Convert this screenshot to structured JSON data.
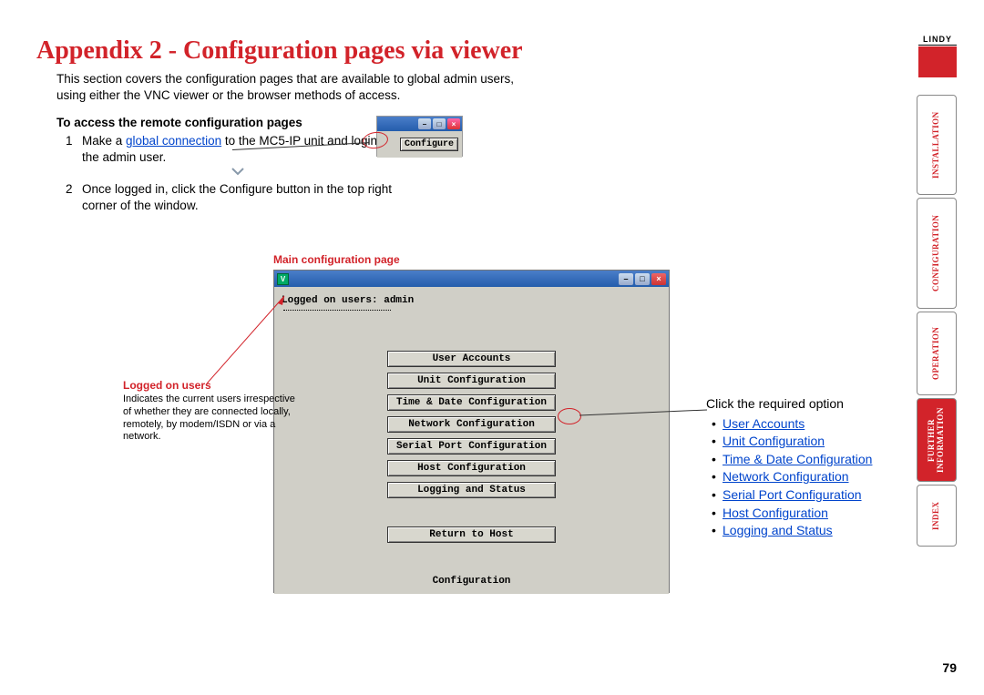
{
  "title": "Appendix 2 - Configuration pages via viewer",
  "intro": "This section covers the configuration pages that are available to global admin users, using either the VNC viewer or the browser methods of access.",
  "subhead": "To access the remote configuration pages",
  "step1_pre": "Make a ",
  "step1_link": "global connection",
  "step1_post": " to the MC5-IP unit and login as the admin user.",
  "step2": "Once logged in, click the Configure button in the top right corner of the window.",
  "mini_btn": "Configure",
  "main_label": "Main configuration page",
  "logged_line": "Logged on users: admin",
  "buttons": [
    "User Accounts",
    "Unit Configuration",
    "Time & Date Configuration",
    "Network Configuration",
    "Serial Port Configuration",
    "Host Configuration",
    "Logging and Status"
  ],
  "return_btn": "Return to Host",
  "cfg_text": "Configuration",
  "logged_label": "Logged on users",
  "logged_desc": "Indicates the current users irrespective of whether they are connected locally, remotely, by modem/ISDN or via a network.",
  "right_lead": "Click the required option",
  "right_links": [
    "User Accounts",
    "Unit Configuration",
    "Time & Date Configuration",
    "Network Configuration",
    "Serial Port Configuration",
    "Host Configuration",
    "Logging and Status"
  ],
  "logo": "LINDY",
  "tabs": [
    {
      "label": "INSTALLATION",
      "active": false
    },
    {
      "label": "CONFIGURATION",
      "active": false
    },
    {
      "label": "OPERATION",
      "active": false
    },
    {
      "label": "FURTHER\nINFORMATION",
      "active": true
    },
    {
      "label": "INDEX",
      "active": false
    }
  ],
  "page_num": "79"
}
